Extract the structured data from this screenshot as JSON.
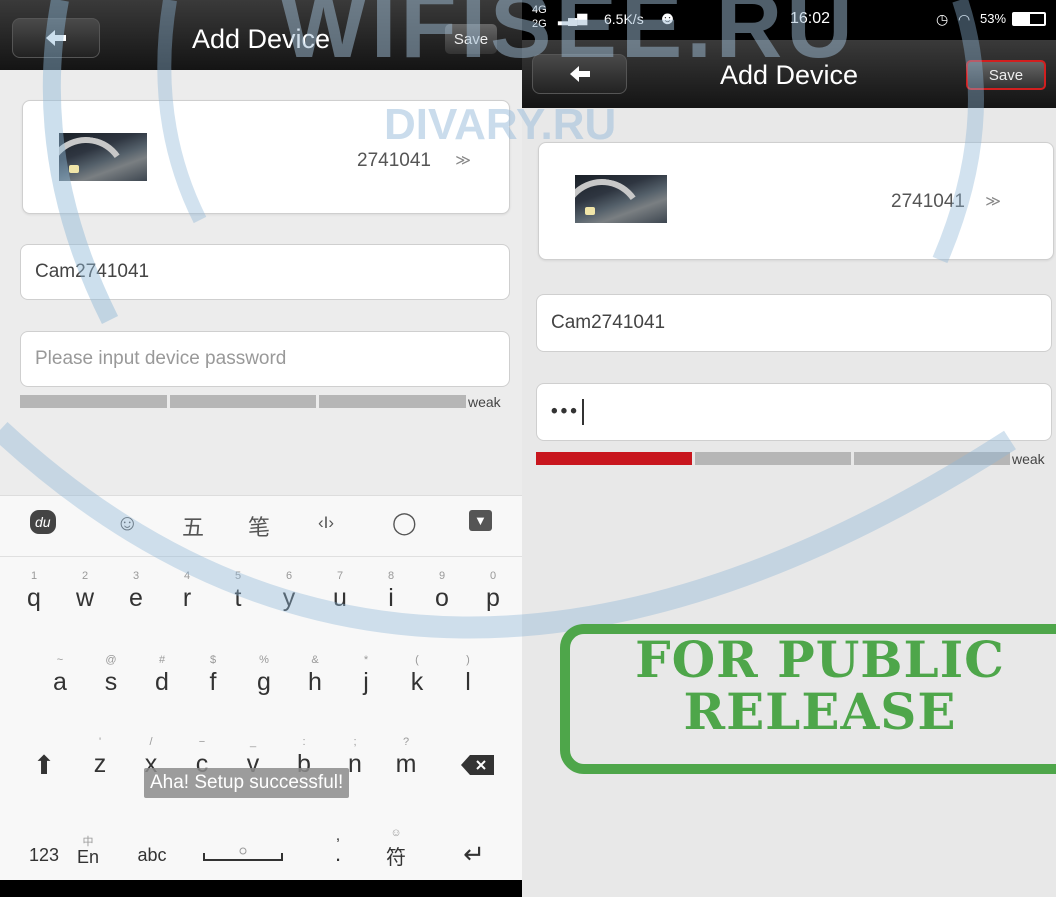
{
  "left": {
    "header": {
      "title": "Add Device",
      "save_label": "Save"
    },
    "device": {
      "id": "2741041",
      "chevron": "≫"
    },
    "name_field": {
      "value": "Cam2741041"
    },
    "password_field": {
      "placeholder": "Please input device password"
    },
    "strength": {
      "label": "weak",
      "level": 0
    },
    "keyboard": {
      "toolbar": [
        "du",
        "☺",
        "五",
        "笔",
        "‹I›",
        "◯",
        "▼"
      ],
      "row1": [
        {
          "hint": "1",
          "key": "q"
        },
        {
          "hint": "2",
          "key": "w"
        },
        {
          "hint": "3",
          "key": "e"
        },
        {
          "hint": "4",
          "key": "r"
        },
        {
          "hint": "5",
          "key": "t"
        },
        {
          "hint": "6",
          "key": "y"
        },
        {
          "hint": "7",
          "key": "u"
        },
        {
          "hint": "8",
          "key": "i"
        },
        {
          "hint": "9",
          "key": "o"
        },
        {
          "hint": "0",
          "key": "p"
        }
      ],
      "row2": [
        {
          "hint": "~",
          "key": "a"
        },
        {
          "hint": "@",
          "key": "s"
        },
        {
          "hint": "#",
          "key": "d"
        },
        {
          "hint": "$",
          "key": "f"
        },
        {
          "hint": "%",
          "key": "g"
        },
        {
          "hint": "&",
          "key": "h"
        },
        {
          "hint": "*",
          "key": "j"
        },
        {
          "hint": "(",
          "key": "k"
        },
        {
          "hint": ")",
          "key": "l"
        }
      ],
      "row3": [
        {
          "hint": "'",
          "key": "z"
        },
        {
          "hint": "/",
          "key": "x"
        },
        {
          "hint": "−",
          "key": "c"
        },
        {
          "hint": "_",
          "key": "v"
        },
        {
          "hint": ":",
          "key": "b"
        },
        {
          "hint": ";",
          "key": "n"
        },
        {
          "hint": "?",
          "key": "m"
        }
      ],
      "row4": {
        "num": "123",
        "lang_hint": "中",
        "lang": "En",
        "abc": "abc",
        "punct_hint": ",",
        "punct": ".",
        "sym_hint": "☺",
        "sym": "符"
      }
    },
    "toast": "Aha! Setup successful!"
  },
  "right": {
    "status": {
      "net1": "4G",
      "net2": "2G",
      "speed": "6.5K/s",
      "time": "16:02",
      "battery": "53%"
    },
    "header": {
      "title": "Add Device",
      "save_label": "Save"
    },
    "device": {
      "id": "2741041",
      "chevron": "≫"
    },
    "name_field": {
      "value": "Cam2741041"
    },
    "password_field": {
      "value": "•••"
    },
    "strength": {
      "label": "weak",
      "level": 1
    }
  },
  "watermarks": {
    "wifi": "WIFISEE.RU",
    "divary": "DIVARY.RU"
  },
  "stamp": {
    "line1": "FOR PUBLIC",
    "line2": "RELEASE"
  },
  "colors": {
    "accent_red": "#c8161e",
    "stamp_green": "#4ea64a"
  }
}
